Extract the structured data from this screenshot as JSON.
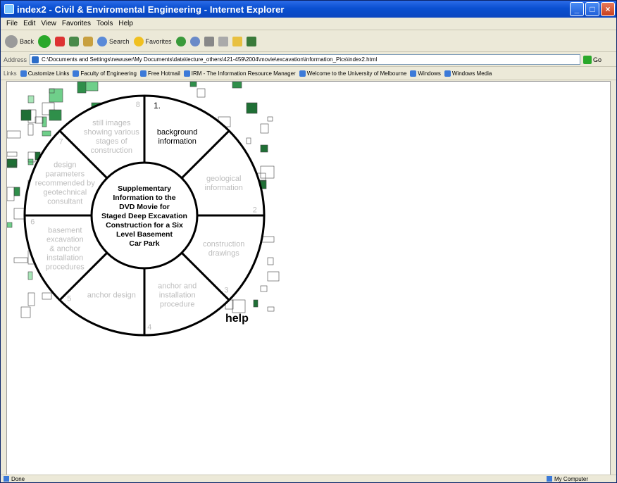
{
  "window": {
    "title": "index2 - Civil & Enviromental Engineering - Internet Explorer"
  },
  "menu": [
    "File",
    "Edit",
    "View",
    "Favorites",
    "Tools",
    "Help"
  ],
  "toolbar": {
    "back": "Back",
    "search": "Search",
    "favorites": "Favorites"
  },
  "address": {
    "label": "Address",
    "value": "C:\\Documents and Settings\\newuser\\My Documents\\data\\lecture_others\\421-459\\2004\\movie\\excavation\\information_Pics\\index2.html",
    "go": "Go"
  },
  "links": {
    "label": "Links",
    "items": [
      "Customize Links",
      "Faculty of Engineering",
      "Free Hotmail",
      "IRM - The Information Resource Manager",
      "Welcome to the University of Melbourne",
      "Windows",
      "Windows Media"
    ]
  },
  "wheel": {
    "center_lines": [
      "Supplementary",
      "Information to the",
      "DVD Movie for",
      "Staged Deep Excavation",
      "Construction for a Six",
      "Level Basement",
      "Car Park"
    ],
    "segments": [
      {
        "number": "1.",
        "lines": [
          "background",
          "information"
        ]
      },
      {
        "number": "2",
        "lines": [
          "geological",
          "information"
        ]
      },
      {
        "number": "3",
        "lines": [
          "construction",
          "drawings"
        ]
      },
      {
        "number": "4",
        "lines": [
          "anchor and",
          "installation",
          "procedure"
        ]
      },
      {
        "number": "5",
        "lines": [
          "anchor design"
        ]
      },
      {
        "number": "6",
        "lines": [
          "basement",
          "excavation",
          "& anchor",
          "installation",
          "procedures"
        ]
      },
      {
        "number": "7",
        "lines": [
          "design",
          "parameters",
          "recommended by",
          "geotechnical",
          "consultant"
        ]
      },
      {
        "number": "8",
        "lines": [
          "still images",
          "showing various",
          "stages of",
          "construction"
        ]
      }
    ],
    "help": "help"
  },
  "status": {
    "left": "Done",
    "right": "My Computer"
  },
  "colors": {
    "titlebar": "#0a4fd0",
    "tile_green": "#3f9e5a"
  }
}
